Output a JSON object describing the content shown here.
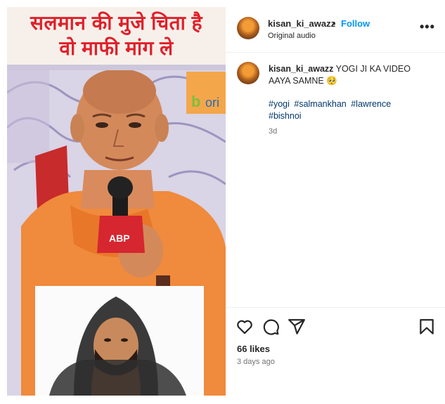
{
  "media": {
    "overlay_line1": "सलमान की मुजे चिता है",
    "overlay_line2": "वो माफी मांग ले",
    "mic_label": "ABP"
  },
  "header": {
    "username": "kisan_ki_awazz",
    "separator": "•",
    "follow_label": "Follow",
    "audio_label": "Original audio",
    "more_icon": "more-horizontal-icon"
  },
  "caption": {
    "username": "kisan_ki_awazz",
    "text": "YOGI JI KA VIDEO AAYA SAMNE 🥺",
    "hashtags": [
      "#yogi",
      "#salmankhan",
      "#lawrence",
      "#bishnoi"
    ],
    "time": "3d"
  },
  "actions": {
    "icons": [
      "heart-icon",
      "comment-icon",
      "share-icon",
      "bookmark-icon"
    ],
    "likes": "66 likes",
    "ago": "3 days ago"
  },
  "colors": {
    "accent": "#0095f6",
    "overlay_text": "#e0202a",
    "robe": "#f08a3c"
  }
}
